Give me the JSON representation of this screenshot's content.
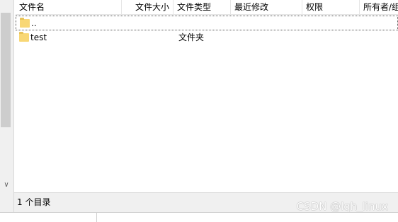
{
  "columns": {
    "name": "文件名",
    "size": "文件大小",
    "type": "文件类型",
    "modified": "最近修改",
    "permissions": "权限",
    "owner": "所有者/组"
  },
  "sort_indicator": "^",
  "rows": [
    {
      "name": "..",
      "size": "",
      "type": "",
      "icon": "folder-icon"
    },
    {
      "name": "test",
      "size": "",
      "type": "文件夹",
      "icon": "folder-icon"
    }
  ],
  "status": {
    "text": "1 个目录"
  },
  "left_scroll_arrow": "∨",
  "watermark": "CSDN @lqh_linux",
  "colors": {
    "folder": "#f8d775",
    "status_bar": "#f0f0f0"
  }
}
